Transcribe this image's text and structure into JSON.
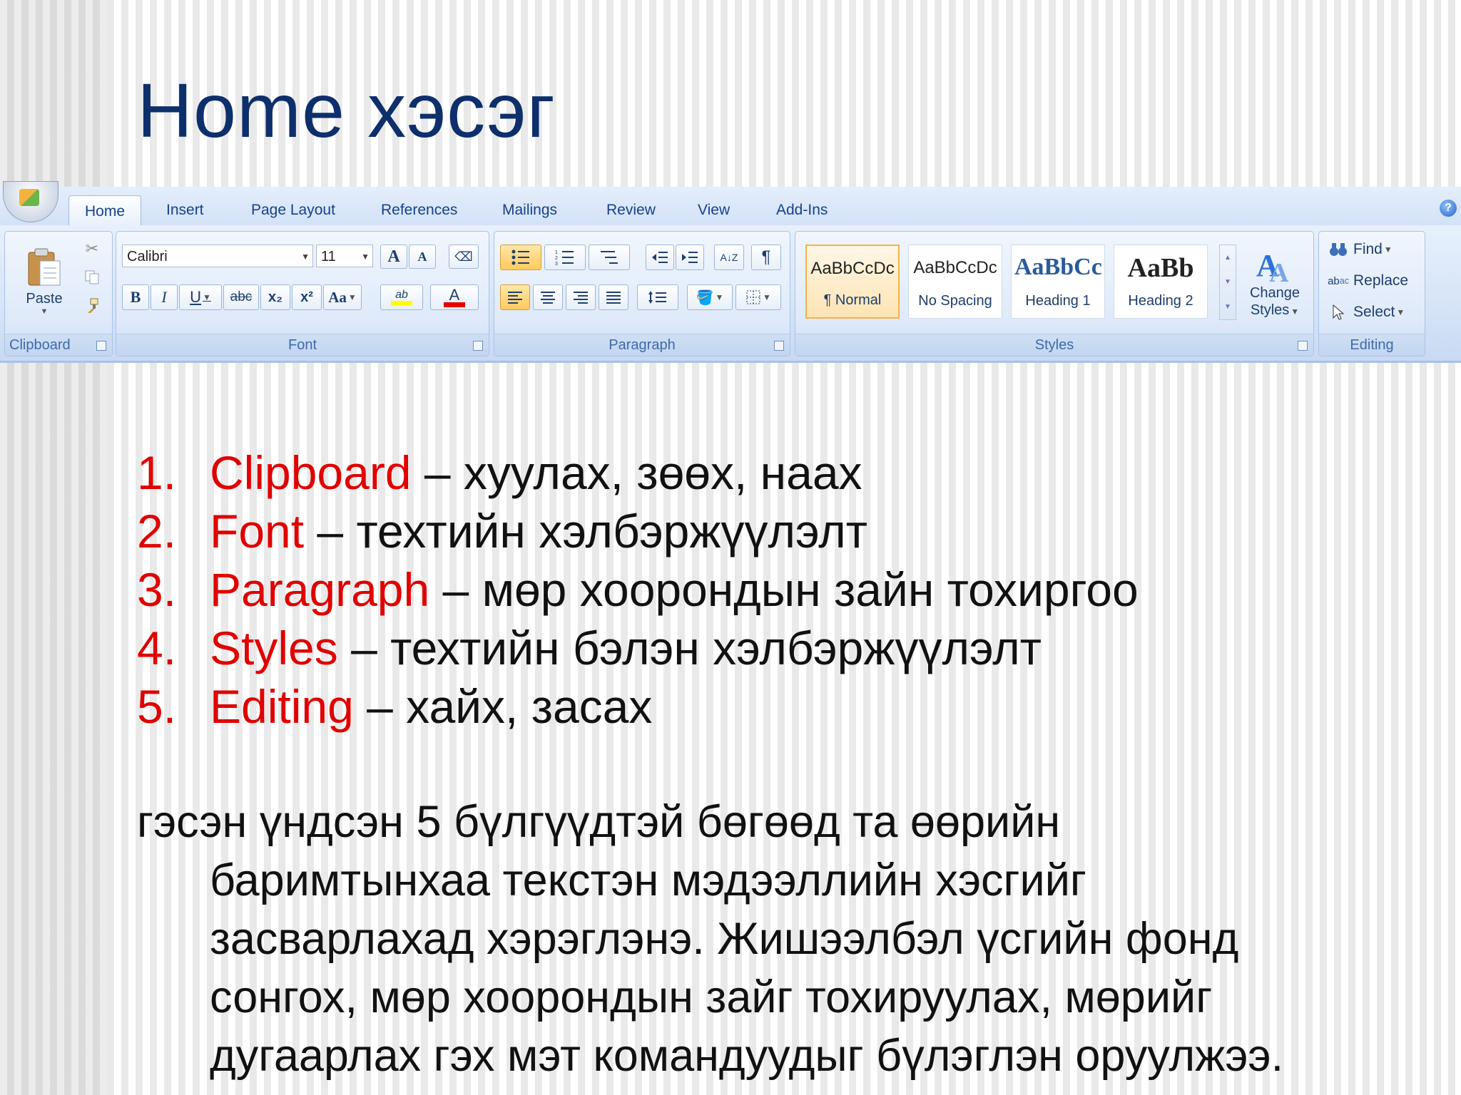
{
  "slide": {
    "title": "Home хэсэг"
  },
  "ribbon": {
    "tabs": [
      "Home",
      "Insert",
      "Page Layout",
      "References",
      "Mailings",
      "Review",
      "View",
      "Add-Ins"
    ],
    "active_tab": "Home",
    "clipboard": {
      "paste_label": "Paste",
      "group_label": "Clipboard"
    },
    "font": {
      "font_name": "Calibri",
      "font_size": "11",
      "group_label": "Font",
      "bold": "B",
      "italic": "I",
      "underline": "U",
      "strike": "abc",
      "subscript": "x₂",
      "superscript": "x²",
      "change_case": "Aa",
      "grow": "A",
      "shrink": "A",
      "highlight": "ab",
      "font_color": "A",
      "highlight_color": "#ffff00",
      "font_color_bar": "#e60000"
    },
    "paragraph": {
      "group_label": "Paragraph",
      "pilcrow": "¶"
    },
    "styles": {
      "group_label": "Styles",
      "items": [
        {
          "sample": "AaBbCcDc",
          "name": "¶ Normal"
        },
        {
          "sample": "AaBbCcDc",
          "name": "No Spacing"
        },
        {
          "sample": "AaBbCc",
          "name": "Heading 1"
        },
        {
          "sample": "AaBb",
          "name": "Heading 2"
        }
      ],
      "change_styles_line1": "Change",
      "change_styles_line2": "Styles"
    },
    "editing": {
      "group_label": "Editing",
      "find": "Find",
      "replace": "Replace",
      "select": "Select"
    }
  },
  "content": {
    "items": [
      {
        "num": "1.",
        "keyword": "Clipboard",
        "rest": " – хуулах, зөөх, наах"
      },
      {
        "num": "2.",
        "keyword": "Font",
        "rest": " – техтийн хэлбэржүүлэлт"
      },
      {
        "num": "3.",
        "keyword": "Paragraph",
        "rest": " – мөр хоорондын зайн тохиргоо"
      },
      {
        "num": "4.",
        "keyword": "Styles",
        "rest": " – техтийн бэлэн хэлбэржүүлэлт"
      },
      {
        "num": "5.",
        "keyword": "Editing",
        "rest": " – хайх, засах"
      }
    ],
    "paragraph_first": "гэсэн үндсэн 5 бүлгүүдтэй бөгөөд та өөрийн",
    "paragraph_lines": [
      "баримтынхаа текстэн мэдээллийн хэсгийг",
      "засварлахад хэрэглэнэ. Жишээлбэл үсгийн фонд",
      "сонгох, мөр хоорондын зайг тохируулах, мөрийг",
      "дугаарлах гэх мэт командуудыг бүлэглэн оруулжээ."
    ]
  },
  "colors": {
    "title": "#0d2f6b",
    "keyword": "#e10000",
    "ribbon_text": "#15428b"
  }
}
